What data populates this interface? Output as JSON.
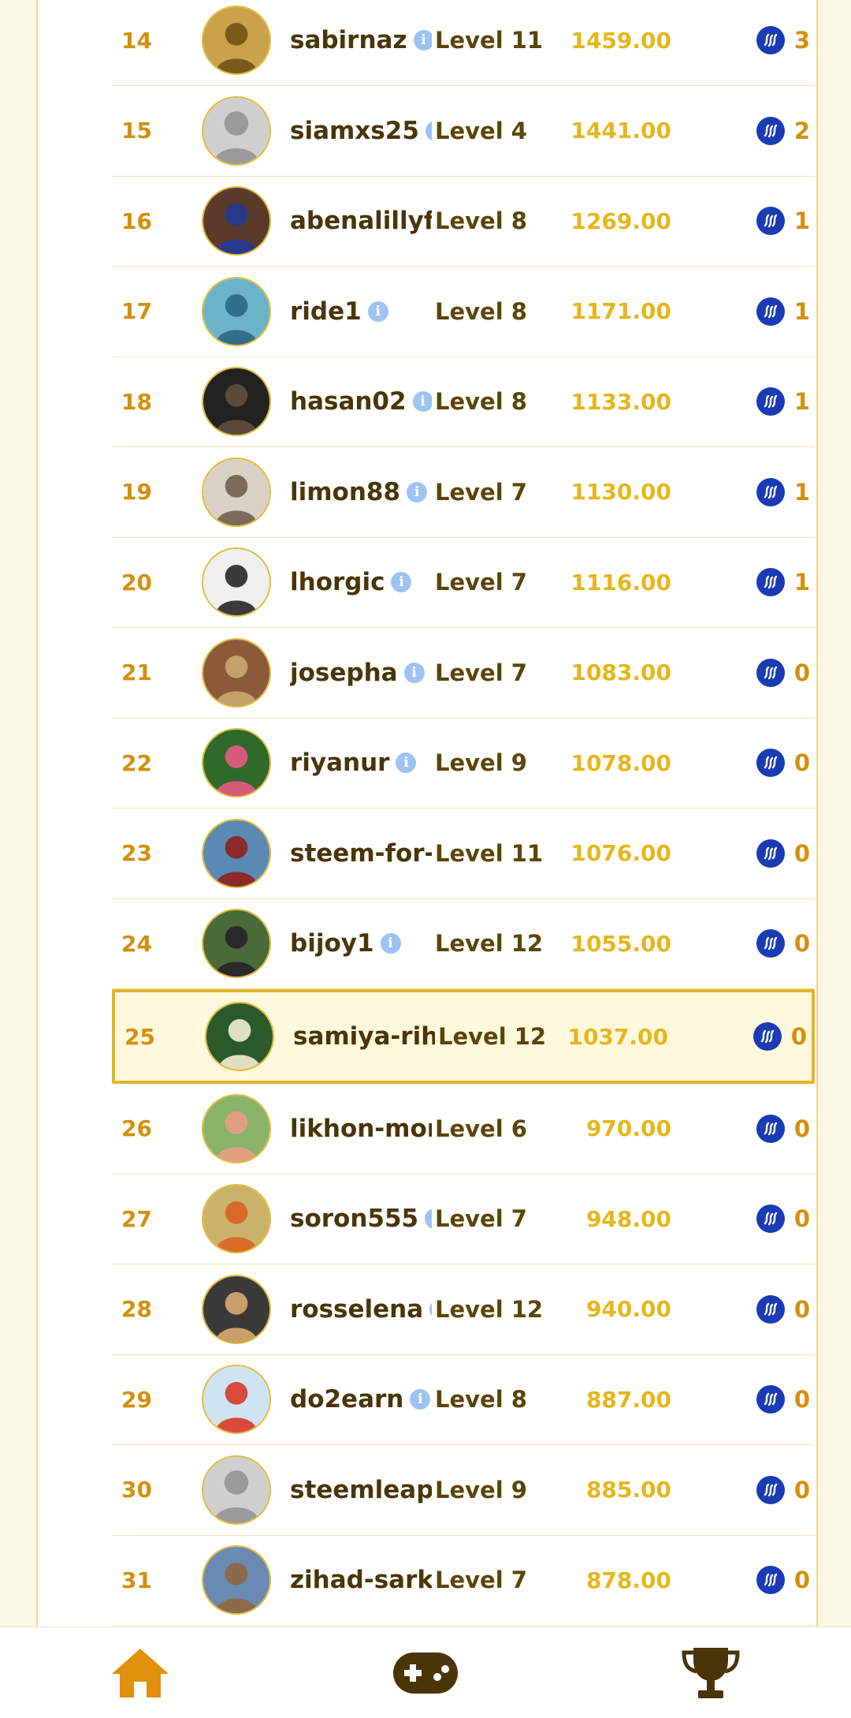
{
  "leaderboard": {
    "rows": [
      {
        "rank": "",
        "username": "",
        "level": "",
        "score": "",
        "reward": ""
      },
      {
        "rank": "14",
        "username": "sabirnaz",
        "level": "Level 11",
        "score": "1459.00",
        "reward": "3"
      },
      {
        "rank": "15",
        "username": "siamxs25",
        "level": "Level 4",
        "score": "1441.00",
        "reward": "2"
      },
      {
        "rank": "16",
        "username": "abenalillyf",
        "level": "Level 8",
        "score": "1269.00",
        "reward": "1"
      },
      {
        "rank": "17",
        "username": "ride1",
        "level": "Level 8",
        "score": "1171.00",
        "reward": "1"
      },
      {
        "rank": "18",
        "username": "hasan02",
        "level": "Level 8",
        "score": "1133.00",
        "reward": "1"
      },
      {
        "rank": "19",
        "username": "limon88",
        "level": "Level 7",
        "score": "1130.00",
        "reward": "1"
      },
      {
        "rank": "20",
        "username": "lhorgic",
        "level": "Level 7",
        "score": "1116.00",
        "reward": "1"
      },
      {
        "rank": "21",
        "username": "josepha",
        "level": "Level 7",
        "score": "1083.00",
        "reward": "0"
      },
      {
        "rank": "22",
        "username": "riyanur",
        "level": "Level 9",
        "score": "1078.00",
        "reward": "0"
      },
      {
        "rank": "23",
        "username": "steem-for-",
        "level": "Level 11",
        "score": "1076.00",
        "reward": "0"
      },
      {
        "rank": "24",
        "username": "bijoy1",
        "level": "Level 12",
        "score": "1055.00",
        "reward": "0"
      },
      {
        "rank": "25",
        "username": "samiya-rih",
        "level": "Level 12",
        "score": "1037.00",
        "reward": "0"
      },
      {
        "rank": "26",
        "username": "likhon-mor",
        "level": "Level 6",
        "score": "970.00",
        "reward": "0"
      },
      {
        "rank": "27",
        "username": "soron555",
        "level": "Level 7",
        "score": "948.00",
        "reward": "0"
      },
      {
        "rank": "28",
        "username": "rosselena",
        "level": "Level 12",
        "score": "940.00",
        "reward": "0"
      },
      {
        "rank": "29",
        "username": "do2earn",
        "level": "Level 8",
        "score": "887.00",
        "reward": "0"
      },
      {
        "rank": "30",
        "username": "steemleap",
        "level": "Level 9",
        "score": "885.00",
        "reward": "0"
      },
      {
        "rank": "31",
        "username": "zihad-sark",
        "level": "Level 7",
        "score": "878.00",
        "reward": "0"
      }
    ],
    "highlighted_rank": "25",
    "info_icon_glyph": "i"
  },
  "nav": {
    "items": [
      {
        "name": "home",
        "icon": "home-icon"
      },
      {
        "name": "games",
        "icon": "gamepad-icon"
      },
      {
        "name": "leaderboard",
        "icon": "trophy-icon"
      }
    ]
  },
  "colors": {
    "rank": "#d4900d",
    "score": "#e6b61c",
    "level": "#5c4409",
    "username": "#4a3508",
    "steem": "#1a3bb3",
    "highlight_border": "#e0b528",
    "home_icon": "#e0900c",
    "dark_icon": "#4a3508"
  }
}
